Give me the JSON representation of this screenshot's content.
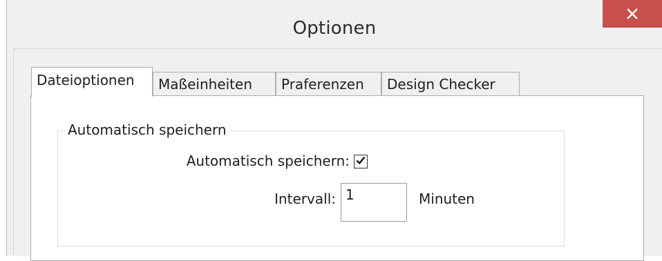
{
  "window": {
    "title": "Optionen"
  },
  "tabs": [
    {
      "label": "Dateioptionen",
      "active": true
    },
    {
      "label": "Maßeinheiten",
      "active": false
    },
    {
      "label": "Praferenzen",
      "active": false
    },
    {
      "label": "Design Checker",
      "active": false
    }
  ],
  "autosave": {
    "group_title": "Automatisch speichern",
    "checkbox_label": "Automatisch speichern:",
    "checked": true,
    "interval_label": "Intervall:",
    "interval_value": "1",
    "interval_unit": "Minuten"
  },
  "colors": {
    "close_button": "#c7504a",
    "window_bg": "#f0f0f0",
    "panel_bg": "#ffffff"
  }
}
